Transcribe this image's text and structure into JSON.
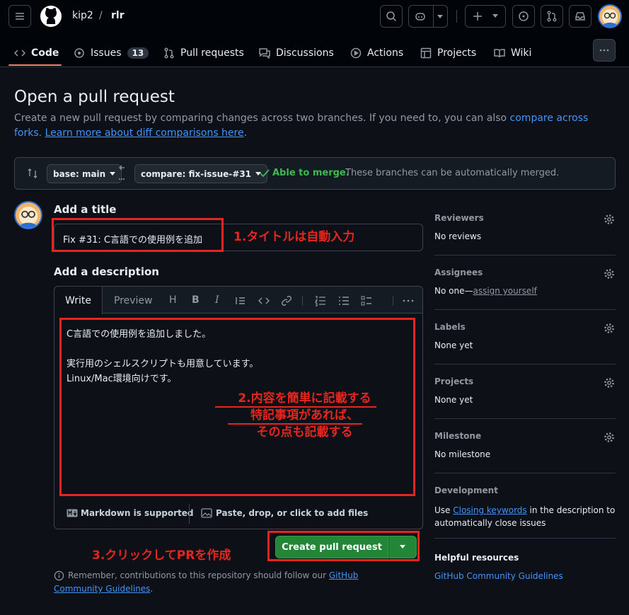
{
  "header": {
    "owner": "kip2",
    "separator": "/",
    "repo": "rlr"
  },
  "tabs": [
    {
      "label": "Code",
      "icon": "code-icon"
    },
    {
      "label": "Issues",
      "icon": "issue-icon",
      "count": "13"
    },
    {
      "label": "Pull requests",
      "icon": "pull-request-icon"
    },
    {
      "label": "Discussions",
      "icon": "discussion-icon"
    },
    {
      "label": "Actions",
      "icon": "play-icon"
    },
    {
      "label": "Projects",
      "icon": "table-icon"
    },
    {
      "label": "Wiki",
      "icon": "book-icon"
    }
  ],
  "page": {
    "title": "Open a pull request",
    "desc_prefix": "Create a new pull request by comparing changes across two branches. If you need to, you can also ",
    "compare_forks": "compare across forks.",
    "learn_more": "Learn more about diff comparisons here",
    "period": "."
  },
  "compare_bar": {
    "base": "base: main",
    "compare": "compare: fix-issue-#31",
    "able": "Able to merge.",
    "able_msg": "These branches can be automatically merged."
  },
  "form": {
    "title_label": "Add a title",
    "title_value": "Fix #31: C言語での使用例を追加",
    "desc_label": "Add a description",
    "tab_write": "Write",
    "tab_preview": "Preview",
    "body_lines": [
      "C言語での使用例を追加しました。",
      "",
      "実行用のシェルスクリプトも用意しています。",
      "Linux/Mac環境向けです。"
    ],
    "markdown_note": "Markdown is supported",
    "attach_note": "Paste, drop, or click to add files",
    "create_button": "Create pull request",
    "remember_prefix": "Remember, contributions to this repository should follow our ",
    "guidelines_link": "GitHub Community Guidelines",
    "period": "."
  },
  "annotations": {
    "a1": "1.タイトルは自動入力",
    "a2_line1": "2.内容を簡単に記載する",
    "a2_line2": "特記事項があれば、",
    "a2_line3": "その点も記載する",
    "a3": "3.クリックしてPRを作成"
  },
  "sidebar": {
    "reviewers_label": "Reviewers",
    "reviewers_value": "No reviews",
    "assignees_label": "Assignees",
    "assignees_value": "No one—",
    "assign_yourself": "assign yourself",
    "labels_label": "Labels",
    "labels_value": "None yet",
    "projects_label": "Projects",
    "projects_value": "None yet",
    "milestone_label": "Milestone",
    "milestone_value": "No milestone",
    "development_label": "Development",
    "dev_use": "Use ",
    "dev_link": "Closing keywords",
    "dev_rest": " in the description to automatically close issues",
    "helpful_label": "Helpful resources",
    "helpful_link": "GitHub Community Guidelines"
  },
  "colors": {
    "accent": "#4493f8",
    "success": "#3fb950",
    "button_green": "#238636",
    "annotation_red": "#e5251f",
    "background": "#0d1117"
  }
}
